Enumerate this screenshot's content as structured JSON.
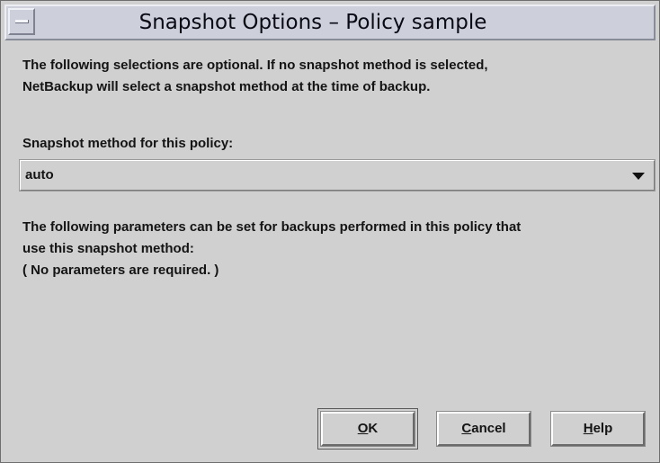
{
  "window": {
    "title": "Snapshot Options – Policy sample"
  },
  "intro": {
    "line1": "The following selections are optional. If no snapshot method is selected,",
    "line2": "NetBackup will select a snapshot method at the time of backup."
  },
  "method": {
    "label": "Snapshot method for this policy:",
    "selected": "auto"
  },
  "params": {
    "line1": "The following parameters can be set for backups performed in this policy that",
    "line2": "use this snapshot method:",
    "line3": "( No parameters are required. )"
  },
  "buttons": {
    "ok": {
      "mnemonic": "O",
      "rest": "K"
    },
    "cancel": {
      "mnemonic": "C",
      "rest": "ancel"
    },
    "help": {
      "mnemonic": "H",
      "rest": "elp"
    }
  },
  "icons": {
    "window_menu": "window-menu-icon",
    "dropdown": "chevron-down-icon"
  }
}
